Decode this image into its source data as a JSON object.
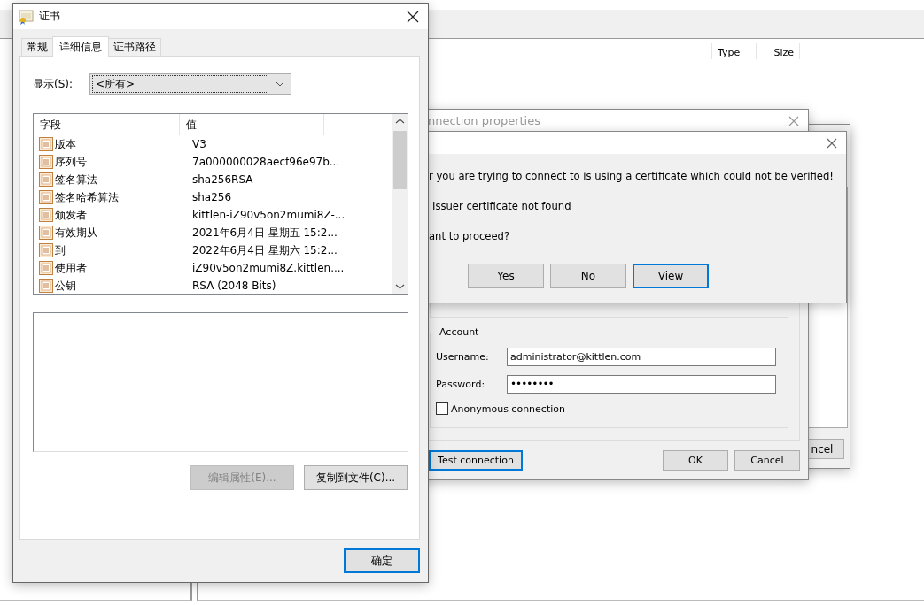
{
  "background_app": {
    "columns": [
      "Type",
      "Size"
    ]
  },
  "back_window": {
    "button": "ncel"
  },
  "connection_window": {
    "title": "nnection properties",
    "group_title": "Account",
    "fields": [
      {
        "label": "Username:",
        "value": "administrator@kittlen.com",
        "kind": "text"
      },
      {
        "label": "Password:",
        "value": "••••••••",
        "kind": "password"
      }
    ],
    "anonymous": {
      "label": "Anonymous connection",
      "checked": false
    },
    "buttons": [
      {
        "label": "Test connection",
        "focused": true
      },
      {
        "label": "OK",
        "focused": false
      },
      {
        "label": "Cancel",
        "focused": false
      }
    ]
  },
  "message_dialog": {
    "lines": [
      "r you are trying to connect to is using a certificate which could not be verified!",
      "Issuer certificate not found",
      "ant to proceed?"
    ],
    "buttons": [
      {
        "label": "Yes",
        "focused": false
      },
      {
        "label": "No",
        "focused": false
      },
      {
        "label": "View",
        "focused": true
      }
    ]
  },
  "certificate_window": {
    "title": "证书",
    "tabs": [
      {
        "label": "常规",
        "selected": false
      },
      {
        "label": "详细信息",
        "selected": true
      },
      {
        "label": "证书路径",
        "selected": false
      }
    ],
    "show_label": "显示(S):",
    "show_value": "<所有>",
    "columns": [
      "字段",
      "值"
    ],
    "rows": [
      {
        "field": "版本",
        "value": "V3"
      },
      {
        "field": "序列号",
        "value": "7a000000028aecf96e97b..."
      },
      {
        "field": "签名算法",
        "value": "sha256RSA"
      },
      {
        "field": "签名哈希算法",
        "value": "sha256"
      },
      {
        "field": "颁发者",
        "value": "kittlen-iZ90v5on2mumi8Z-..."
      },
      {
        "field": "有效期从",
        "value": "2021年6月4日 星期五 15:2..."
      },
      {
        "field": "到",
        "value": "2022年6月4日 星期六 15:2..."
      },
      {
        "field": "使用者",
        "value": "iZ90v5on2mumi8Z.kittlen...."
      },
      {
        "field": "公钥",
        "value": "RSA (2048 Bits)"
      }
    ],
    "buttons": [
      {
        "label": "编辑属性(E)...",
        "disabled": true
      },
      {
        "label": "复制到文件(C)...",
        "disabled": false
      }
    ],
    "ok_button": "确定"
  }
}
